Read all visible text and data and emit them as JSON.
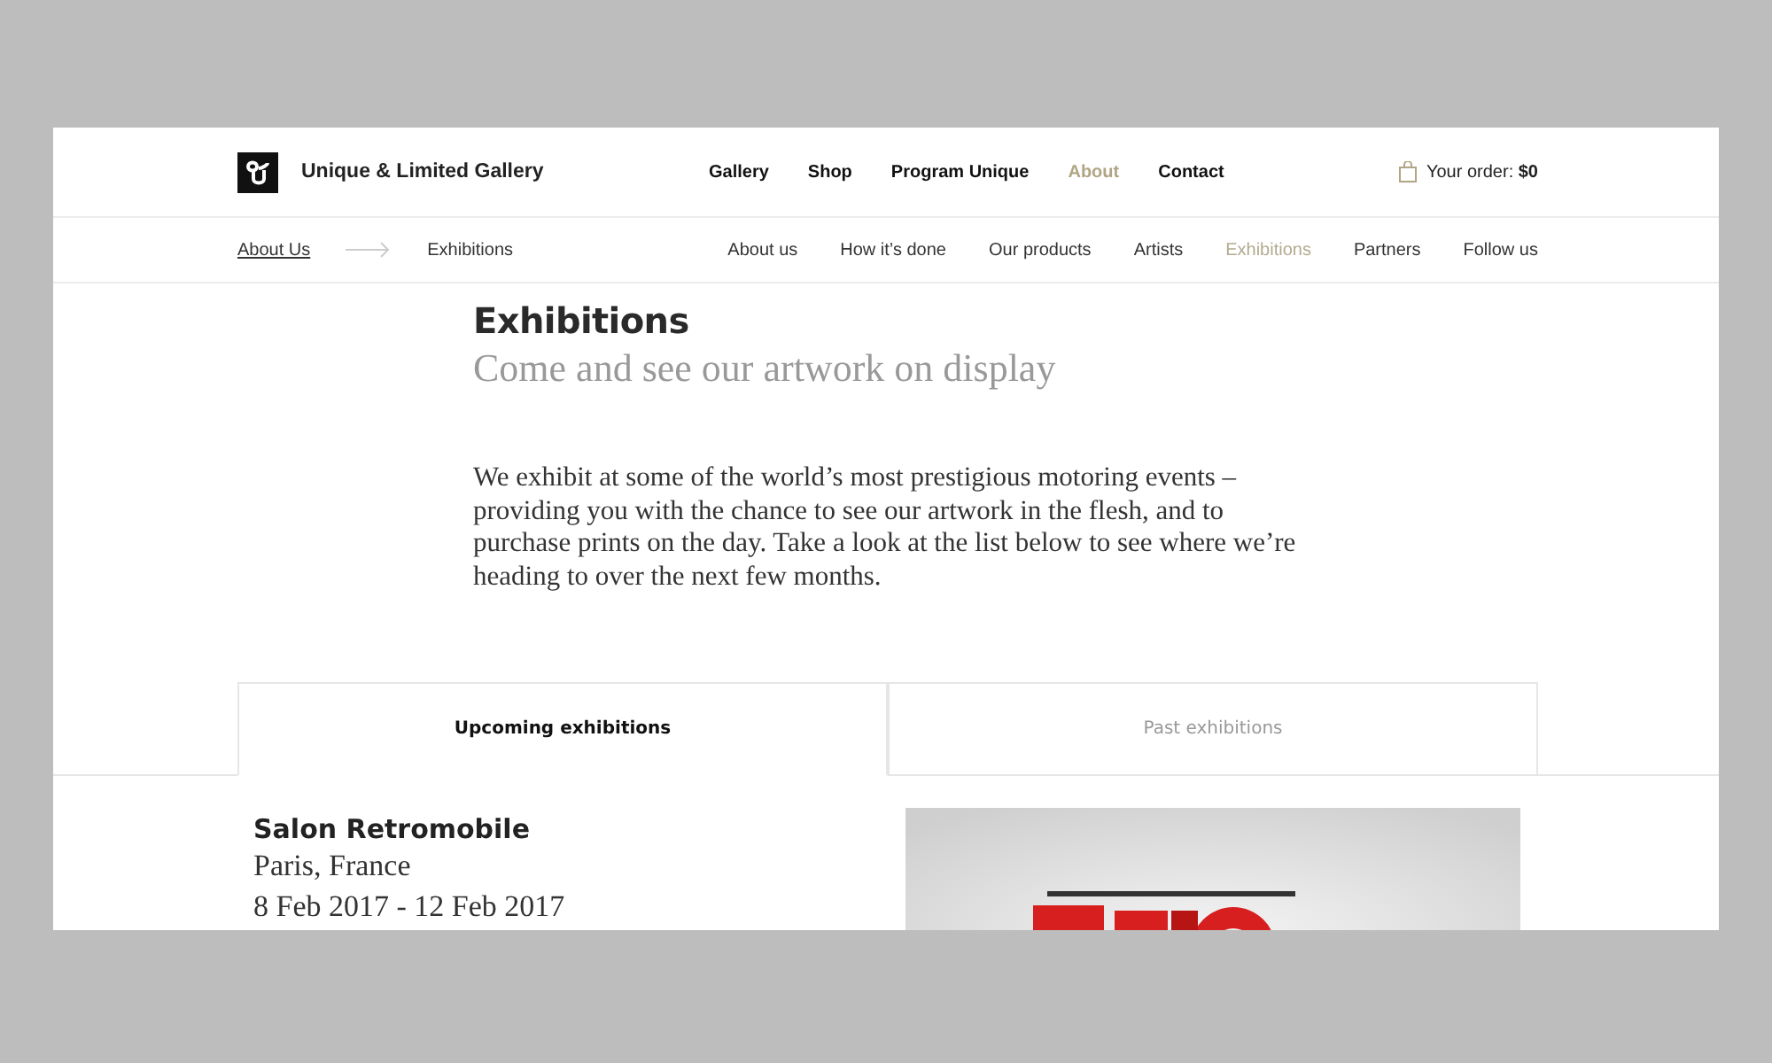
{
  "site": {
    "name": "Unique & Limited Gallery"
  },
  "main_nav": [
    {
      "label": "Gallery",
      "selected": false
    },
    {
      "label": "Shop",
      "selected": false
    },
    {
      "label": "Program Unique",
      "selected": false
    },
    {
      "label": "About",
      "selected": true
    },
    {
      "label": "Contact",
      "selected": false
    }
  ],
  "cart": {
    "label": "Your order:",
    "amount": "$0"
  },
  "breadcrumb": [
    {
      "label": "About Us",
      "kind": "link"
    },
    {
      "label": "Exhibitions",
      "kind": "current"
    }
  ],
  "sub_nav": [
    {
      "label": "About us",
      "selected": false
    },
    {
      "label": "How it’s done",
      "selected": false
    },
    {
      "label": "Our products",
      "selected": false
    },
    {
      "label": "Artists",
      "selected": false
    },
    {
      "label": "Exhibitions",
      "selected": true
    },
    {
      "label": "Partners",
      "selected": false
    },
    {
      "label": "Follow us",
      "selected": false
    }
  ],
  "page": {
    "title": "Exhibitions",
    "subtitle": "Come and see our artwork on display",
    "intro": "We exhibit at some of the world’s most prestigious motoring events – providing you with the chance to see our artwork in the flesh, and to purchase prints on the day. Take a look at the list below to see where we’re heading to over the next few months."
  },
  "tabs": [
    {
      "label": "Upcoming exhibitions",
      "selected": true
    },
    {
      "label": "Past exhibitions",
      "selected": false
    }
  ],
  "exhibitions": [
    {
      "name": "Salon Retromobile",
      "place": "Paris, France",
      "dates": "8 Feb 2017 - 12 Feb 2017"
    }
  ]
}
